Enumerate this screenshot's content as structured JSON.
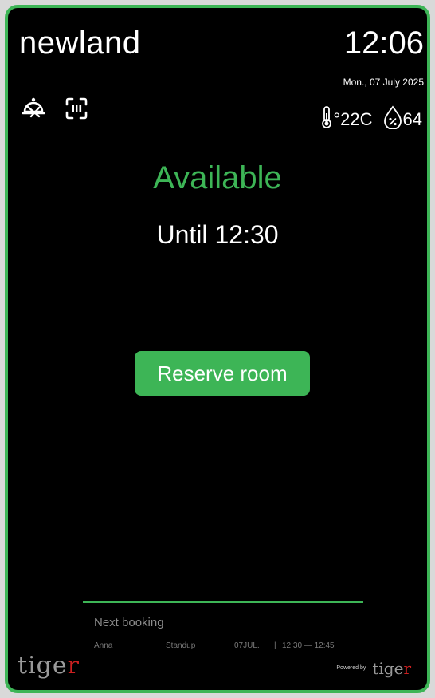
{
  "header": {
    "room_name": "newland",
    "time": "12:06",
    "date": "Mon., 07 July 2025"
  },
  "toolbar": {
    "left_icons": [
      "room-service-icon",
      "qr-scan-icon"
    ]
  },
  "environment": {
    "temperature_icon": "thermometer-icon",
    "temperature": "°22C",
    "humidity_icon": "humidity-drop-icon",
    "humidity": "64"
  },
  "status": {
    "label": "Available",
    "until_prefix": "Until",
    "until_time": "12:30"
  },
  "reserve_button": {
    "label": "Reserve room"
  },
  "next_booking": {
    "title": "Next booking",
    "organizer": "Anna",
    "meeting_title": "Standup",
    "date": "07JUL.",
    "separator": "|",
    "time_range": "12:30 — 12:45"
  },
  "branding": {
    "logo_main": "tige",
    "logo_accent": "r",
    "powered_by_label": "Powered by",
    "powered_logo_main": "tige",
    "powered_logo_accent": "r"
  },
  "colors": {
    "accent": "#3db556",
    "background": "#000000",
    "logo_accent": "#cc2020"
  }
}
